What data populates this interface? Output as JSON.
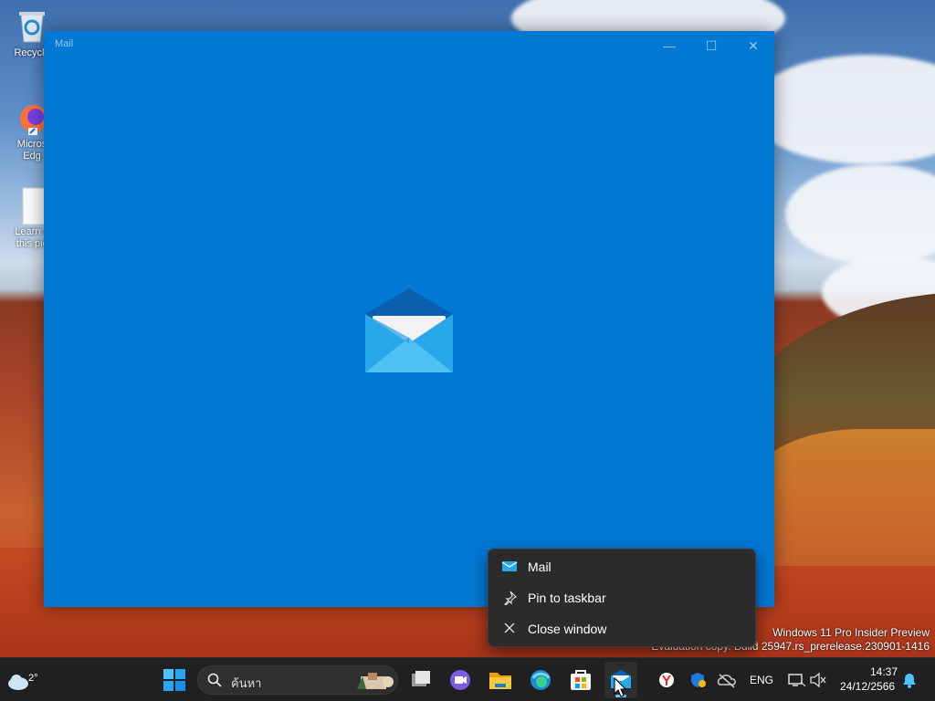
{
  "desktop": {
    "icons": [
      {
        "label": "Recycle"
      },
      {
        "label": "Micros\nEdg"
      },
      {
        "label": "Learn a\nthis pic"
      }
    ],
    "watermark": {
      "line1": "Windows 11 Pro Insider Preview",
      "line2": "Evaluation copy. Build 25947.rs_prerelease.230901-1416"
    }
  },
  "window": {
    "title": "Mail",
    "controls": {
      "minimize": "—",
      "maximize": "☐",
      "close": "✕"
    },
    "accent": "#0078d4"
  },
  "context_menu": {
    "items": [
      {
        "label": "Mail",
        "icon": "mail-icon"
      },
      {
        "label": "Pin to taskbar",
        "icon": "pin-icon"
      },
      {
        "label": "Close window",
        "icon": "close-icon"
      }
    ]
  },
  "taskbar": {
    "weather_temp": "2°",
    "search_placeholder": "ค้นหา",
    "apps": [
      "start-icon",
      "task-view-icon",
      "chat-icon",
      "file-explorer-icon",
      "edge-icon",
      "store-icon",
      "mail-icon"
    ],
    "tray": {
      "language": "ENG",
      "time": "14:37",
      "date": "24/12/2566"
    }
  }
}
